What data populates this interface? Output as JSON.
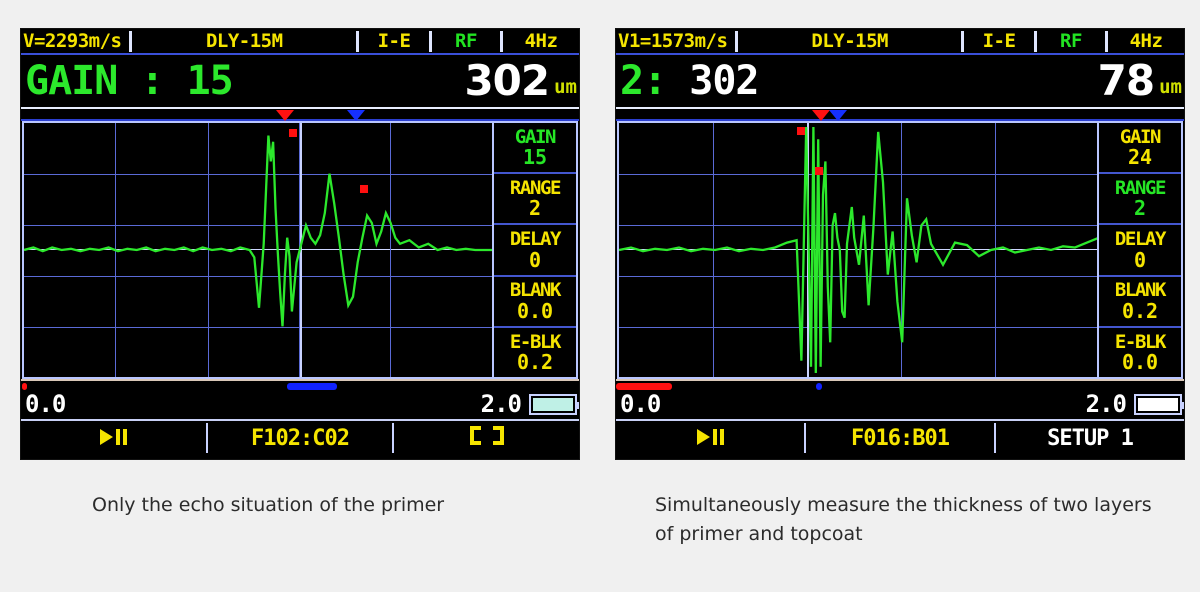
{
  "figure": {
    "background_color": "#f0f0f0",
    "panel_count": 2
  },
  "colors": {
    "screen_background": "#000000",
    "waveform_green": "#2ce82c",
    "label_yellow": "#f5e400",
    "grid_blue": "#5a6ad6",
    "gate_red": "#ff1111",
    "gate_blue": "#1530ff",
    "reading_white": "#ffffff"
  },
  "panels": [
    {
      "id": "device-left",
      "status_bar": {
        "velocity": "V=2293m/s",
        "delay_mode": "DLY-15M",
        "echo_mode": "I-E",
        "display_mode": "RF",
        "frequency": "4Hz"
      },
      "reading": {
        "label": "GAIN :",
        "label_value": "15",
        "value": "302",
        "unit": "um"
      },
      "params": [
        {
          "name": "GAIN",
          "value": "15",
          "color": "green"
        },
        {
          "name": "RANGE",
          "value": "2",
          "color": "yellow"
        },
        {
          "name": "DELAY",
          "value": "0",
          "color": "yellow"
        },
        {
          "name": "BLANK",
          "value": "0.0",
          "color": "yellow"
        },
        {
          "name": "E-BLK",
          "value": "0.2",
          "color": "yellow"
        }
      ],
      "scale": {
        "min": "0.0",
        "max": "2.0",
        "battery": "full"
      },
      "function_bar": {
        "freeze_icon": "play-pause-icon",
        "file_id": "F102:C02",
        "right_label": "",
        "right_icon": "brackets-icon"
      },
      "gate_markers": {
        "red_pct": 56.5,
        "blue_pct": 71.0
      },
      "scale_markers": {
        "red_start_pct": 0.0,
        "red_width_pct": 0.9,
        "blue_start_pct": 57.5,
        "blue_width_pct": 10.5
      },
      "caption": "Only the echo situation of the primer"
    },
    {
      "id": "device-right",
      "status_bar": {
        "velocity": "V1=1573m/s",
        "delay_mode": "DLY-15M",
        "echo_mode": "I-E",
        "display_mode": "RF",
        "frequency": "4Hz"
      },
      "reading": {
        "label": "2:",
        "label_value": "302",
        "value": "78",
        "unit": "um"
      },
      "params": [
        {
          "name": "GAIN",
          "value": "24",
          "color": "yellow"
        },
        {
          "name": "RANGE",
          "value": "2",
          "color": "green"
        },
        {
          "name": "DELAY",
          "value": "0",
          "color": "yellow"
        },
        {
          "name": "BLANK",
          "value": "0.2",
          "color": "yellow"
        },
        {
          "name": "E-BLK",
          "value": "0.0",
          "color": "yellow"
        }
      ],
      "scale": {
        "min": "0.0",
        "max": "2.0",
        "battery": "empty"
      },
      "function_bar": {
        "freeze_icon": "play-pause-icon",
        "file_id": "F016:B01",
        "right_label": "SETUP 1",
        "right_icon": ""
      },
      "gate_markers": {
        "red_pct": 41.5,
        "blue_pct": 44.0
      },
      "scale_markers": {
        "red_start_pct": 0.0,
        "red_width_pct": 11.0,
        "blue_start_pct": 41.0,
        "blue_width_pct": 1.2
      },
      "caption": "Simultaneously measure the thickness of two layers of primer and topcoat"
    }
  ],
  "chart_data": [
    {
      "type": "line",
      "title": "A-scan RF waveform - primer only",
      "xlabel": "",
      "ylabel": "",
      "xlim": [
        0.0,
        2.0
      ],
      "ylim": [
        -1,
        1
      ],
      "grid": true,
      "series": [
        {
          "name": "rf-echo-trace",
          "color": "#2ce82c",
          "x": [
            0.0,
            0.04,
            0.08,
            0.12,
            0.16,
            0.2,
            0.24,
            0.28,
            0.32,
            0.36,
            0.4,
            0.44,
            0.48,
            0.52,
            0.56,
            0.6,
            0.64,
            0.68,
            0.72,
            0.76,
            0.8,
            0.84,
            0.88,
            0.92,
            0.96,
            0.98,
            1.0,
            1.02,
            1.04,
            1.05,
            1.06,
            1.07,
            1.08,
            1.09,
            1.1,
            1.11,
            1.12,
            1.13,
            1.14,
            1.16,
            1.18,
            1.2,
            1.22,
            1.24,
            1.26,
            1.28,
            1.3,
            1.32,
            1.34,
            1.36,
            1.38,
            1.4,
            1.42,
            1.44,
            1.46,
            1.48,
            1.5,
            1.52,
            1.54,
            1.56,
            1.58,
            1.6,
            1.64,
            1.68,
            1.72,
            1.76,
            1.8,
            1.84,
            1.88,
            1.92,
            1.96,
            2.0
          ],
          "y": [
            0.0,
            0.02,
            -0.01,
            0.02,
            0.0,
            0.01,
            -0.01,
            0.01,
            0.0,
            0.02,
            -0.01,
            0.01,
            0.0,
            0.02,
            -0.01,
            0.01,
            0.0,
            0.02,
            -0.01,
            0.02,
            0.0,
            0.01,
            -0.01,
            0.02,
            0.0,
            -0.06,
            -0.47,
            0.05,
            0.93,
            0.72,
            0.88,
            0.34,
            -0.02,
            -0.35,
            -0.62,
            -0.2,
            0.1,
            -0.05,
            -0.5,
            -0.1,
            0.05,
            0.2,
            0.1,
            0.05,
            0.12,
            0.3,
            0.62,
            0.38,
            0.1,
            -0.2,
            -0.45,
            -0.38,
            -0.1,
            0.1,
            0.28,
            0.22,
            0.05,
            0.15,
            0.3,
            0.22,
            0.1,
            0.05,
            0.08,
            0.02,
            0.05,
            0.0,
            0.02,
            0.0,
            0.01,
            0.0,
            0.0,
            0.0
          ]
        }
      ],
      "annotations": [
        {
          "label": "peak-marker-1",
          "x": 1.04,
          "y": 0.95,
          "color": "#ff1010"
        },
        {
          "label": "peak-marker-2",
          "x": 1.3,
          "y": 0.64,
          "color": "#ff1010"
        }
      ]
    },
    {
      "type": "line",
      "title": "A-scan RF waveform - primer and topcoat",
      "xlabel": "",
      "ylabel": "",
      "xlim": [
        0.0,
        2.0
      ],
      "ylim": [
        -1,
        1
      ],
      "grid": true,
      "series": [
        {
          "name": "rf-echo-trace",
          "color": "#2ce82c",
          "x": [
            0.0,
            0.05,
            0.1,
            0.15,
            0.2,
            0.25,
            0.3,
            0.35,
            0.4,
            0.45,
            0.5,
            0.55,
            0.6,
            0.65,
            0.7,
            0.74,
            0.76,
            0.78,
            0.8,
            0.81,
            0.82,
            0.83,
            0.84,
            0.85,
            0.86,
            0.87,
            0.88,
            0.89,
            0.9,
            0.91,
            0.92,
            0.93,
            0.94,
            0.95,
            0.96,
            0.97,
            0.98,
            1.0,
            1.02,
            1.04,
            1.06,
            1.08,
            1.1,
            1.12,
            1.14,
            1.16,
            1.18,
            1.2,
            1.22,
            1.24,
            1.26,
            1.28,
            1.3,
            1.35,
            1.4,
            1.45,
            1.5,
            1.55,
            1.6,
            1.65,
            1.7,
            1.75,
            1.8,
            1.85,
            1.9,
            1.95,
            2.0
          ],
          "y": [
            0.0,
            0.02,
            -0.01,
            0.01,
            0.0,
            0.02,
            -0.01,
            0.01,
            0.0,
            0.02,
            -0.01,
            0.01,
            0.0,
            0.02,
            0.06,
            0.08,
            -0.9,
            1.0,
            -0.95,
            1.0,
            -1.0,
            0.9,
            -0.95,
            0.45,
            0.72,
            -0.3,
            -0.75,
            0.2,
            0.3,
            0.1,
            0.0,
            -0.5,
            -0.55,
            0.05,
            0.2,
            0.35,
            0.1,
            -0.12,
            0.28,
            -0.45,
            0.18,
            0.96,
            0.55,
            -0.2,
            0.15,
            -0.42,
            -0.75,
            0.42,
            0.12,
            -0.1,
            0.2,
            0.25,
            0.05,
            -0.12,
            0.06,
            0.04,
            -0.05,
            0.0,
            0.02,
            -0.02,
            0.0,
            0.02,
            0.0,
            0.03,
            0.02,
            0.06,
            0.1
          ]
        }
      ],
      "annotations": [
        {
          "label": "peak-marker-1",
          "x": 0.79,
          "y": 1.0,
          "color": "#ff1010"
        },
        {
          "label": "peak-marker-2",
          "x": 0.86,
          "y": 0.76,
          "color": "#ff1010"
        }
      ]
    }
  ]
}
